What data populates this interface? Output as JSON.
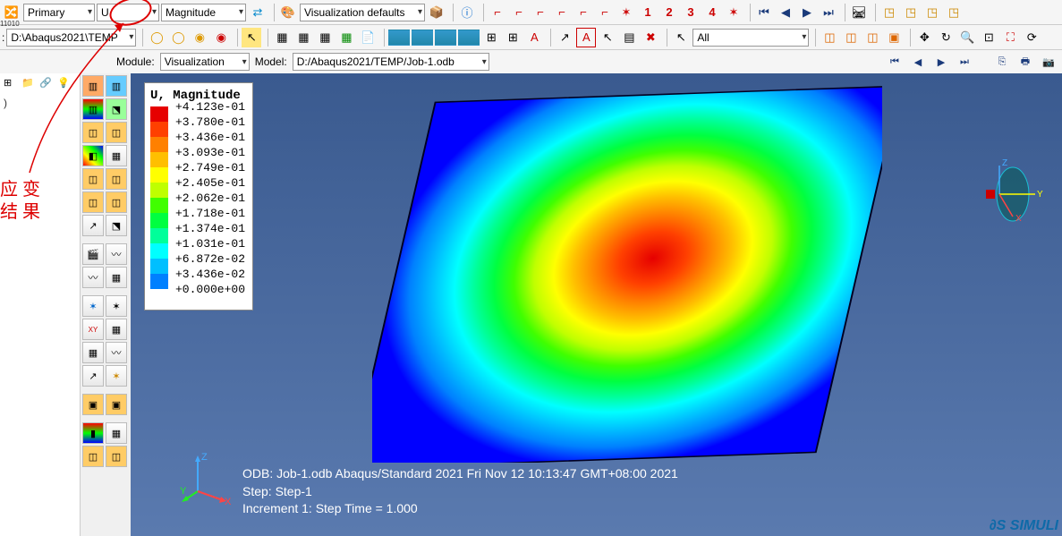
{
  "toolbar1": {
    "variable_type": "Primary",
    "variable": "U",
    "component": "Magnitude",
    "viz_defaults": "Visualization defaults",
    "presets": [
      "1",
      "2",
      "3",
      "4"
    ]
  },
  "toolbar2": {
    "path": "D:\\Abaqus2021\\TEMP",
    "selection_filter": "All"
  },
  "context": {
    "module_label": "Module:",
    "module_value": "Visualization",
    "model_label": "Model:",
    "model_value": "D:/Abaqus2021/TEMP/Job-1.odb"
  },
  "legend": {
    "title": "U, Magnitude",
    "entries": [
      {
        "color": "#e60000",
        "value": "+4.123e-01"
      },
      {
        "color": "#ff4000",
        "value": "+3.780e-01"
      },
      {
        "color": "#ff8000",
        "value": "+3.436e-01"
      },
      {
        "color": "#ffbf00",
        "value": "+3.093e-01"
      },
      {
        "color": "#ffff00",
        "value": "+2.749e-01"
      },
      {
        "color": "#bfff00",
        "value": "+2.405e-01"
      },
      {
        "color": "#40ff00",
        "value": "+2.062e-01"
      },
      {
        "color": "#00ff40",
        "value": "+1.718e-01"
      },
      {
        "color": "#00ff9a",
        "value": "+1.374e-01"
      },
      {
        "color": "#00ffff",
        "value": "+1.031e-01"
      },
      {
        "color": "#00bfff",
        "value": "+6.872e-02"
      },
      {
        "color": "#0080ff",
        "value": "+3.436e-02"
      },
      {
        "color": "#0000ff",
        "value": "+0.000e+00"
      }
    ]
  },
  "info": {
    "line1": "ODB: Job-1.odb    Abaqus/Standard 2021    Fri Nov 12 10:13:47 GMT+08:00 2021",
    "line2": "Step: Step-1",
    "line3": "Increment     1: Step Time =    1.000"
  },
  "axes": {
    "x": "X",
    "y": "Y",
    "z": "Z"
  },
  "annotation": {
    "line1": "应 变",
    "line2": "结 果"
  },
  "branding": "SIMULI",
  "small_label": "11010"
}
